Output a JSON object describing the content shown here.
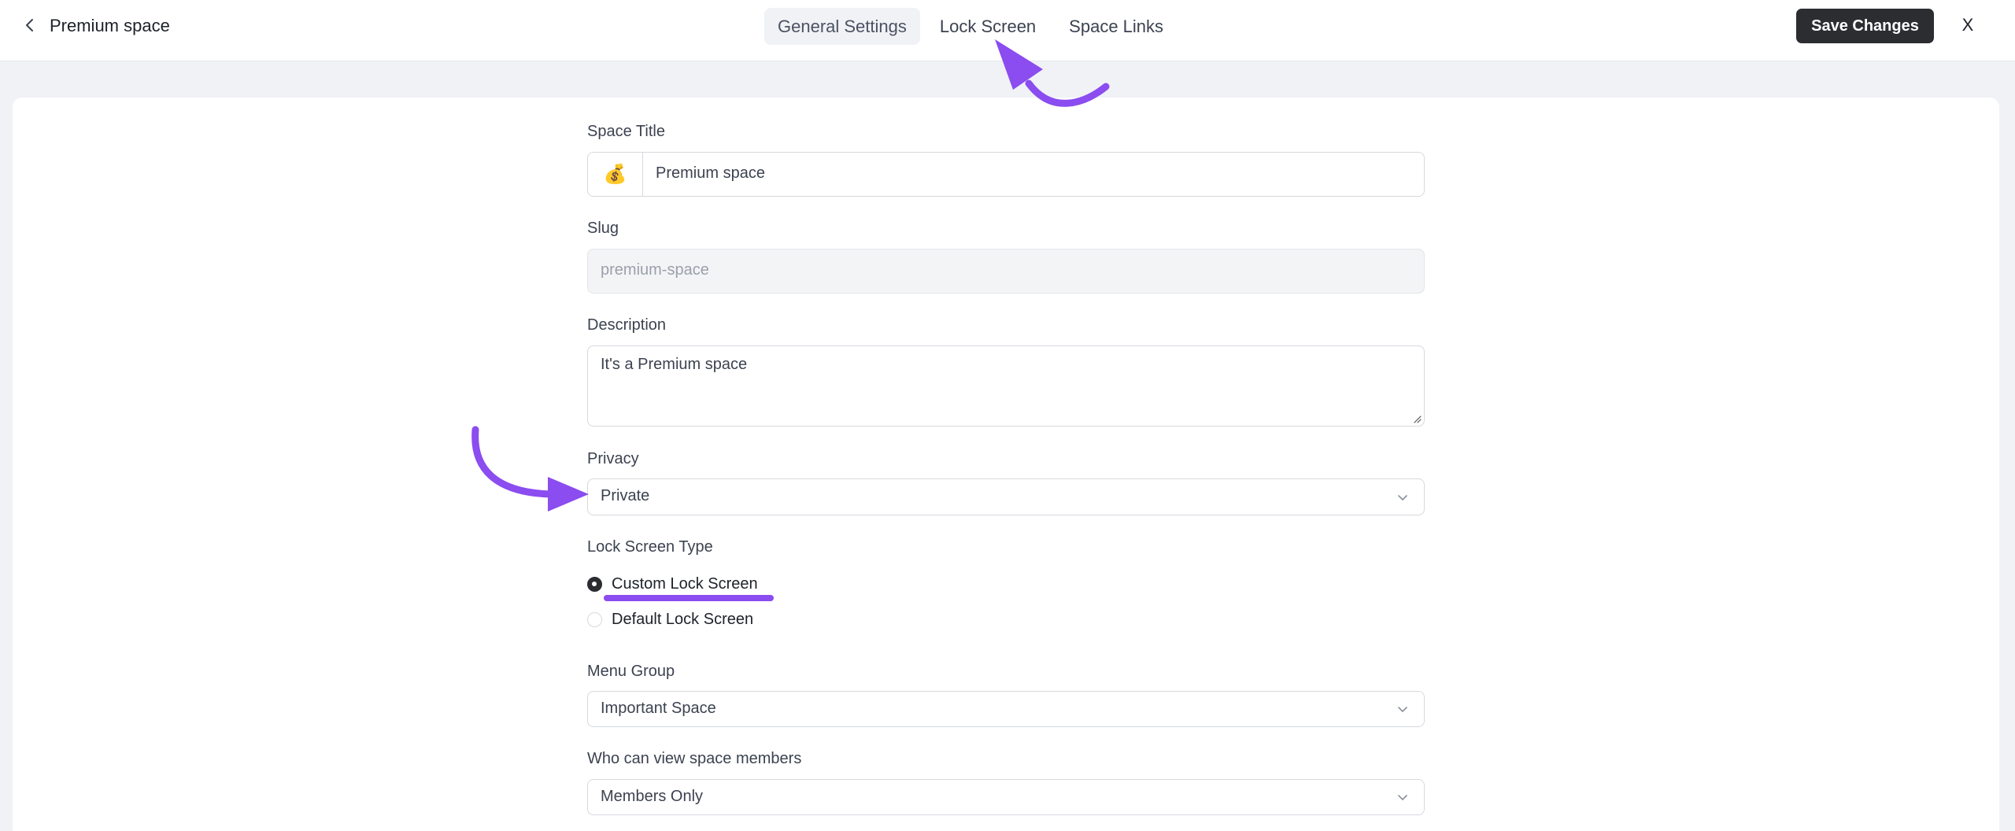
{
  "header": {
    "title": "Premium space",
    "tabs": [
      {
        "label": "General Settings",
        "active": true
      },
      {
        "label": "Lock Screen",
        "active": false
      },
      {
        "label": "Space Links",
        "active": false
      }
    ],
    "save_label": "Save Changes",
    "close_label": "X"
  },
  "form": {
    "space_title": {
      "label": "Space Title",
      "emoji": "💰",
      "value": "Premium space"
    },
    "slug": {
      "label": "Slug",
      "value": "premium-space"
    },
    "description": {
      "label": "Description",
      "value": "It's a Premium space"
    },
    "privacy": {
      "label": "Privacy",
      "value": "Private"
    },
    "lock_screen_type": {
      "label": "Lock Screen Type",
      "options": [
        {
          "label": "Custom Lock Screen",
          "checked": true
        },
        {
          "label": "Default Lock Screen",
          "checked": false
        }
      ]
    },
    "menu_group": {
      "label": "Menu Group",
      "value": "Important Space"
    },
    "member_visibility": {
      "label": "Who can view space members",
      "value": "Members Only"
    }
  },
  "colors": {
    "accent": "#8b4cf0",
    "button": "#2b2d31",
    "background": "#f0f2f5"
  },
  "icons": [
    "chevron-left-icon",
    "chevron-down-icon",
    "money-bag-emoji"
  ]
}
